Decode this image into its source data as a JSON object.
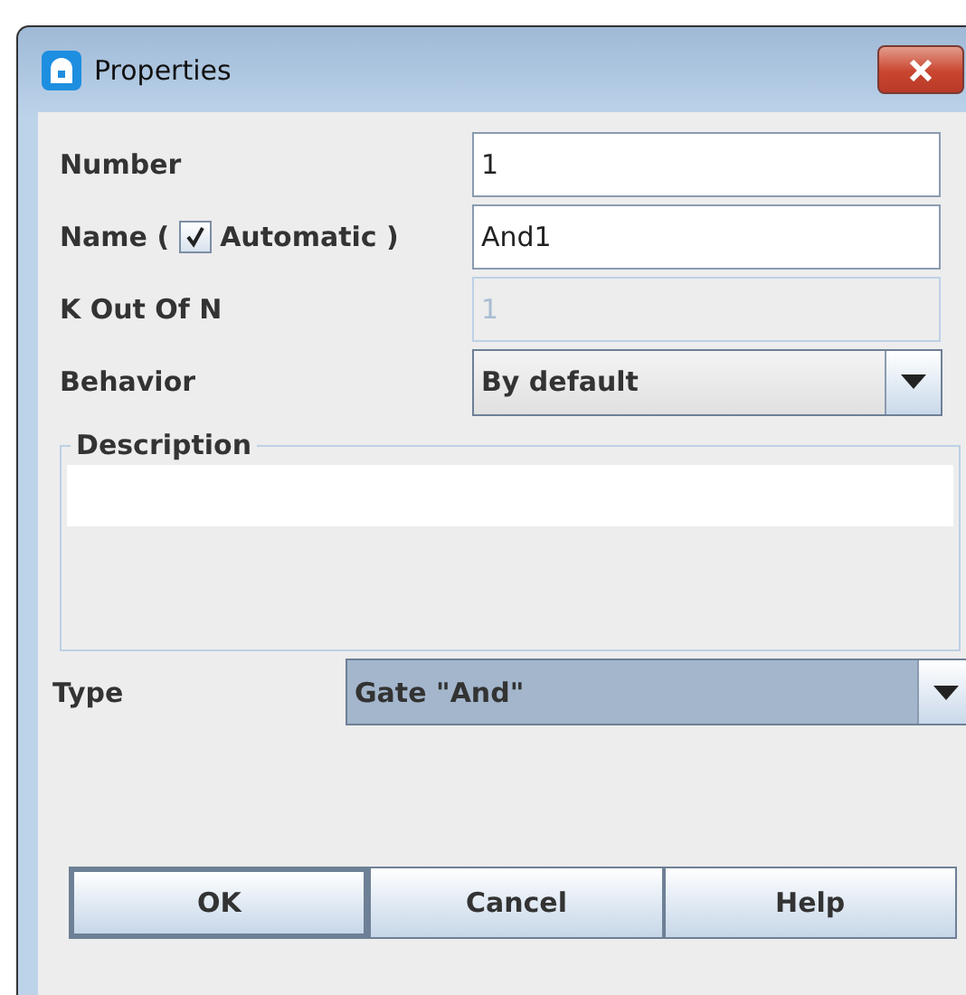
{
  "window": {
    "title": "Properties"
  },
  "fields": [
    {
      "kind": "text",
      "label": "Number",
      "value": "1",
      "disabled": false
    },
    {
      "kind": "name",
      "label": "Name (",
      "checkbox_label": "Automatic )",
      "checked": true,
      "value": "And1",
      "disabled": false
    },
    {
      "kind": "text",
      "label": "K Out Of N",
      "value": "1",
      "disabled": true
    },
    {
      "kind": "combo",
      "label": "Behavior",
      "value": "By default"
    }
  ],
  "description": {
    "label": "Description"
  },
  "type": {
    "label": "Type",
    "value": "Gate \"And\"",
    "selected": true
  },
  "buttons": [
    {
      "label": "OK",
      "focused": true
    },
    {
      "label": "Cancel",
      "focused": false
    },
    {
      "label": "Help",
      "focused": false
    }
  ]
}
